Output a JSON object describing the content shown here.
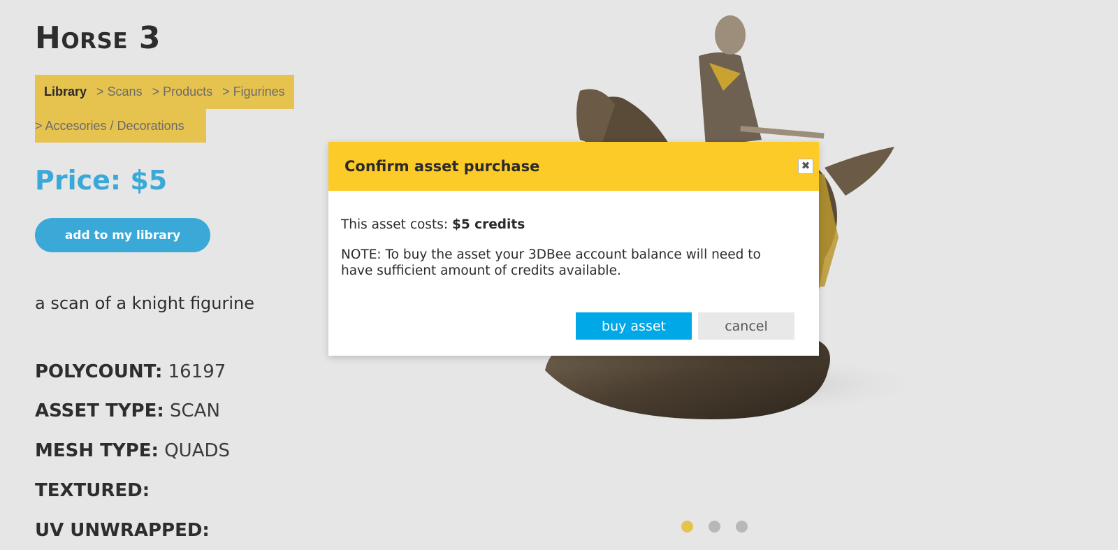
{
  "page": {
    "title": "Horse 3",
    "breadcrumb": {
      "root": "Library",
      "items": [
        "> Scans",
        "> Products",
        "> Figurines",
        "> Accesories / Decorations"
      ]
    },
    "price": "Price: $5",
    "add_button": "add to my library",
    "description": "a scan of a knight figurine",
    "specs": [
      {
        "key": "POLYCOUNT:",
        "value": "16197"
      },
      {
        "key": "ASSET TYPE:",
        "value": "SCAN"
      },
      {
        "key": "MESH TYPE:",
        "value": "QUADS"
      },
      {
        "key": "TEXTURED:",
        "value": ""
      },
      {
        "key": "UV UNWRAPPED:",
        "value": ""
      }
    ]
  },
  "carousel": {
    "count": 3,
    "active": 0
  },
  "modal": {
    "title": "Confirm asset purchase",
    "close_icon": "close-icon",
    "cost_label": "This asset costs:",
    "cost_value": "$5 credits",
    "note": "NOTE: To buy the asset your 3DBee account balance will need to have sufficient amount of credits available.",
    "buy_button": "buy asset",
    "cancel_button": "cancel"
  },
  "colors": {
    "accent_blue": "#3aa9d8",
    "breadcrumb_bg": "#e6c24f",
    "modal_header": "#fdcb27",
    "buy_button": "#00a8e8"
  }
}
